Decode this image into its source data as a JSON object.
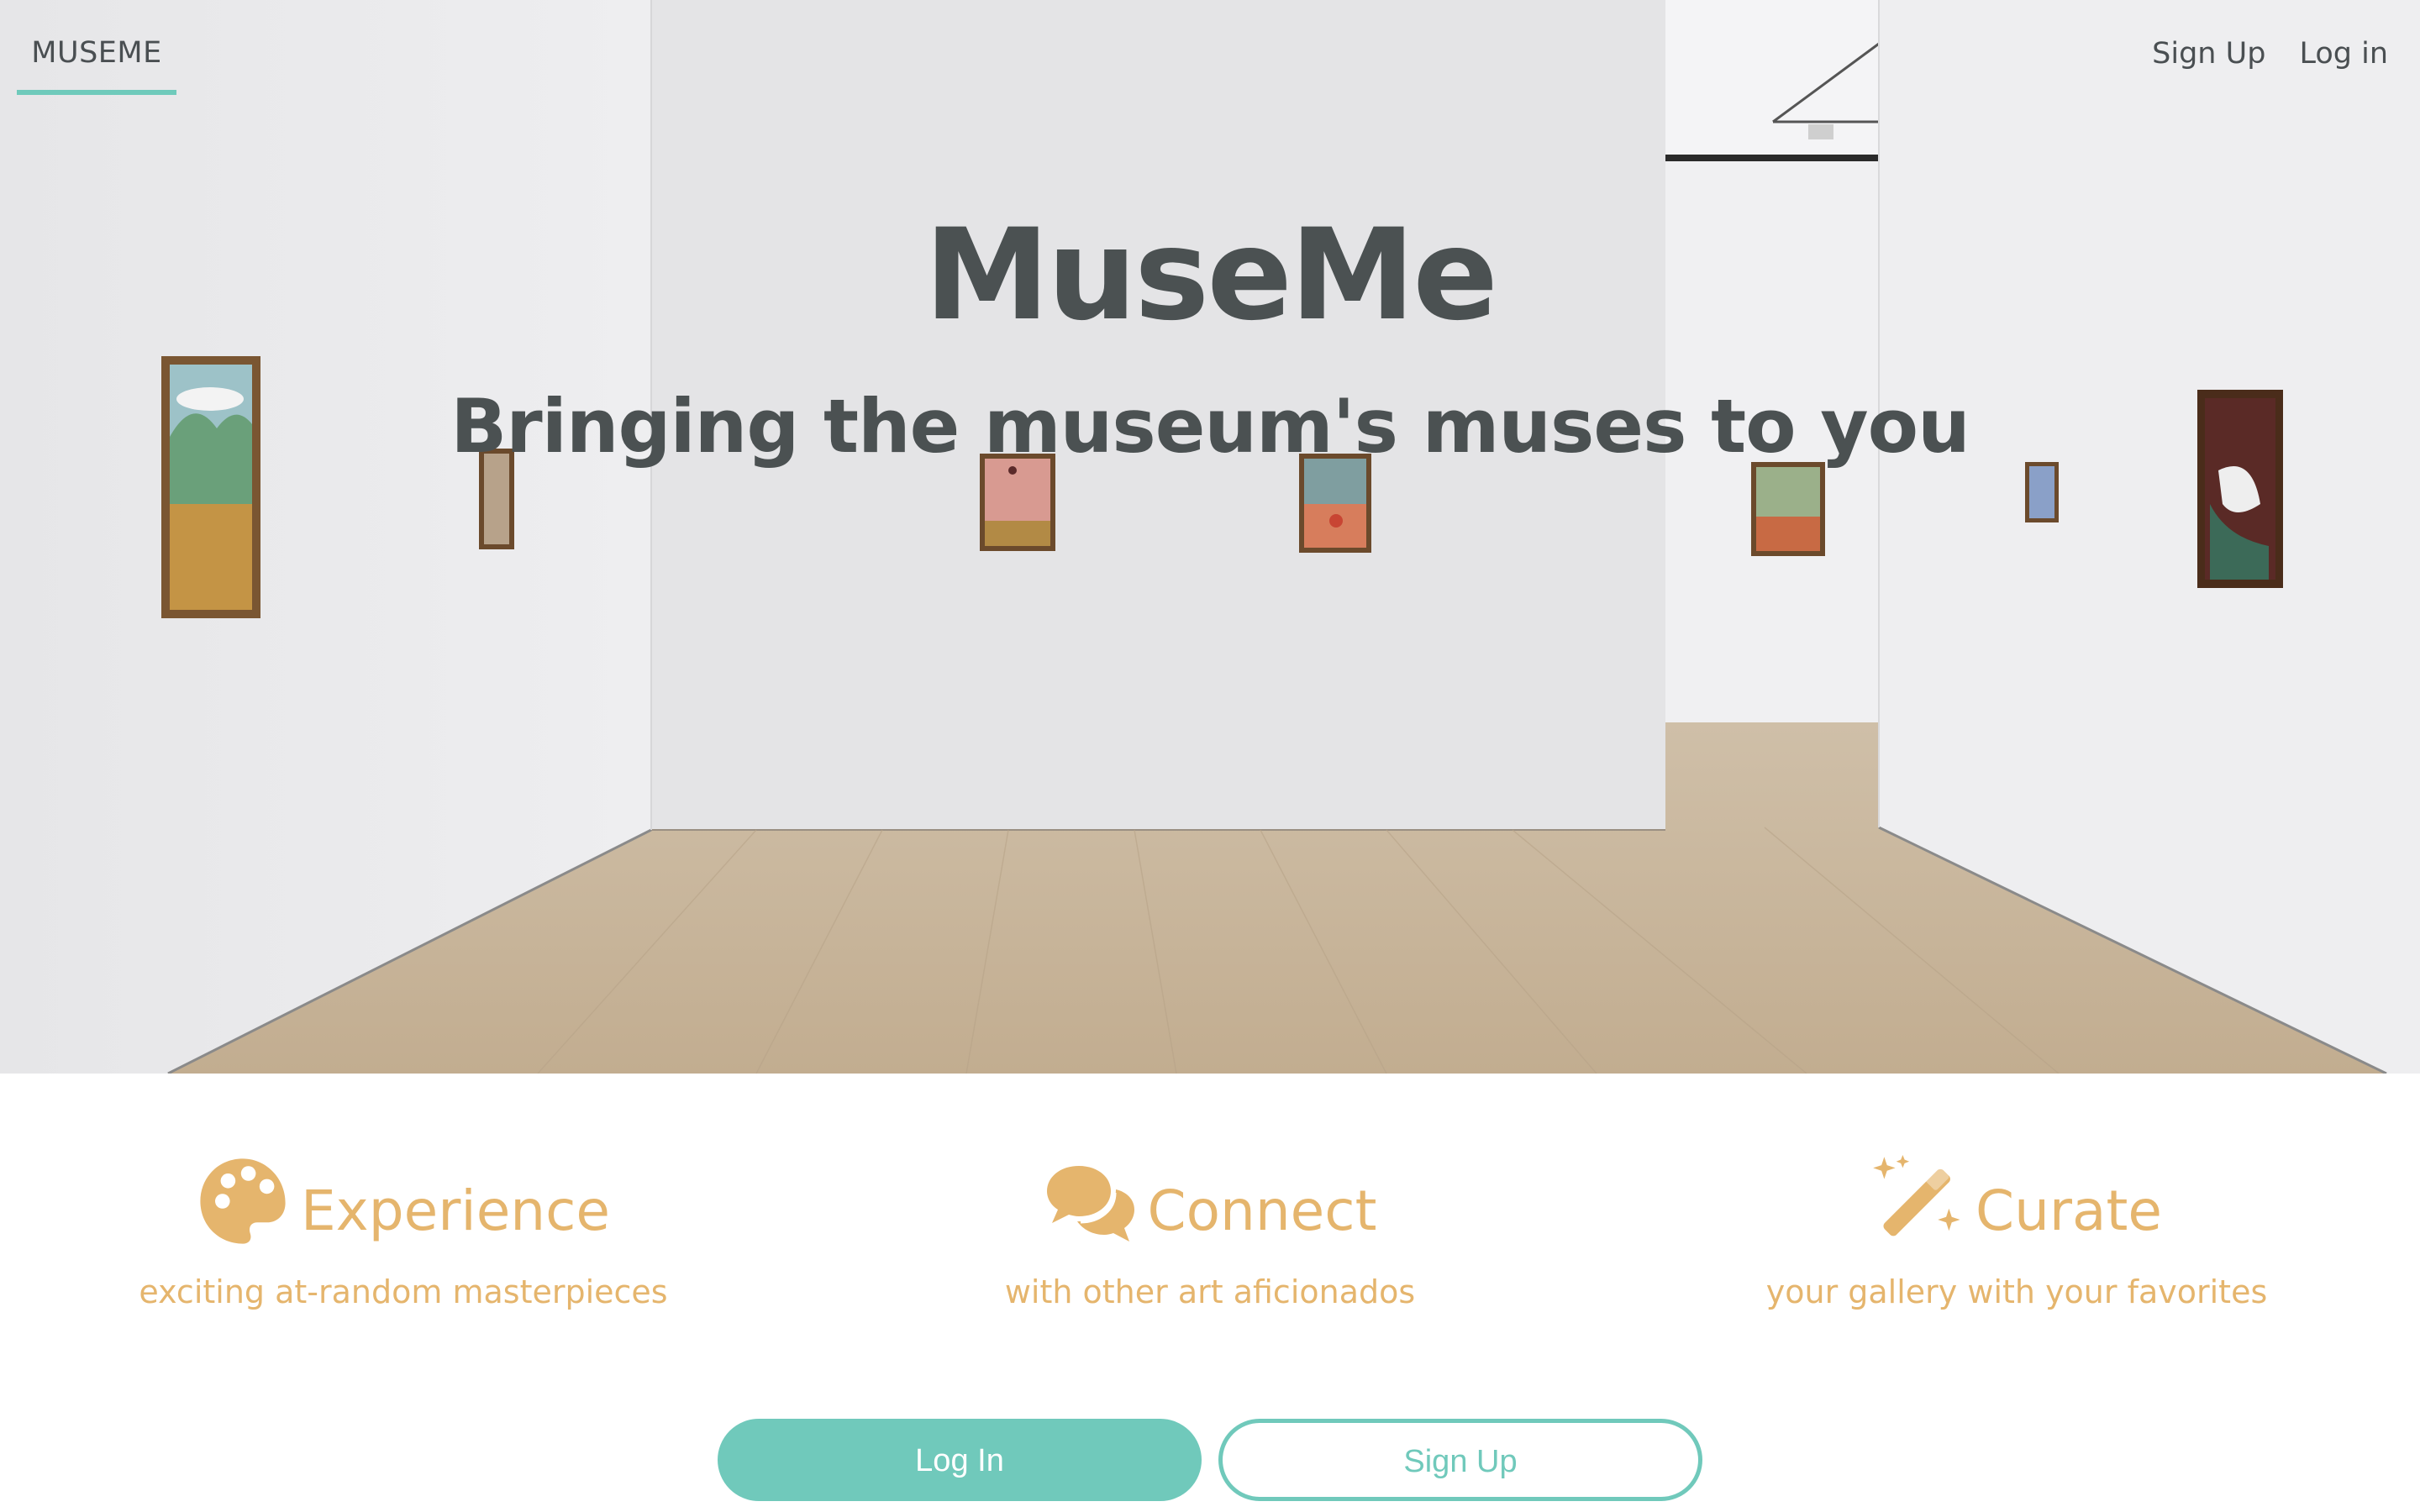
{
  "nav": {
    "brand": "MUSEME",
    "links": [
      {
        "label": "Sign Up"
      },
      {
        "label": "Log in"
      }
    ]
  },
  "hero": {
    "title": "MuseMe",
    "subtitle": "Bringing the museum's muses to you",
    "background": "gallery-room-photo"
  },
  "features": [
    {
      "icon": "palette-icon",
      "title": "Experience",
      "description": "exciting at-random masterpieces"
    },
    {
      "icon": "chat-bubbles-icon",
      "title": "Connect",
      "description": "with other art aficionados"
    },
    {
      "icon": "magic-wand-icon",
      "title": "Curate",
      "description": "your gallery with your favorites"
    }
  ],
  "cta": {
    "login_label": "Log In",
    "signup_label": "Sign Up"
  },
  "colors": {
    "accent": "#70c9bb",
    "feature": "#e5b56d",
    "text_dark": "#4b5152"
  }
}
